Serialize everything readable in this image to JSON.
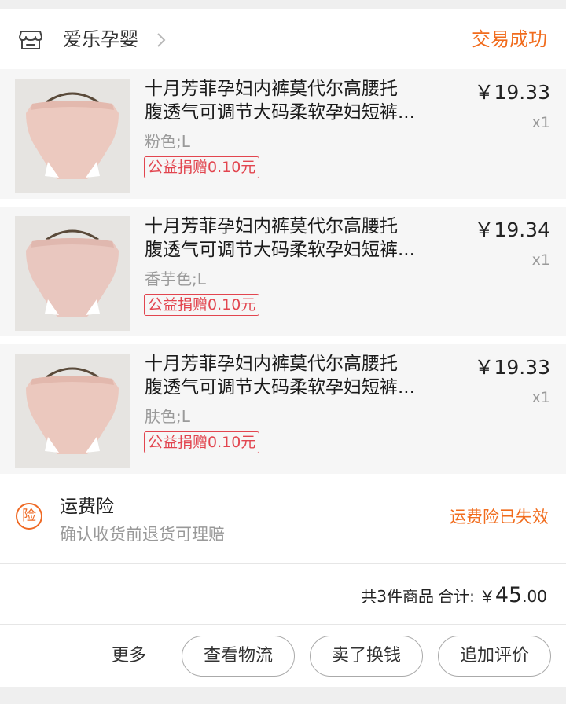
{
  "shop": {
    "name": "爱乐孕婴",
    "status": "交易成功",
    "icon": "store-icon"
  },
  "items": [
    {
      "title_line1": "十月芳菲孕妇内裤莫代尔高腰托",
      "title_line2": "腹透气可调节大码柔软孕妇短裤...",
      "sku": "粉色;L",
      "donation": "公益捐赠0.10元",
      "price": "￥19.33",
      "qty": "x1"
    },
    {
      "title_line1": "十月芳菲孕妇内裤莫代尔高腰托",
      "title_line2": "腹透气可调节大码柔软孕妇短裤...",
      "sku": "香芋色;L",
      "donation": "公益捐赠0.10元",
      "price": "￥19.34",
      "qty": "x1"
    },
    {
      "title_line1": "十月芳菲孕妇内裤莫代尔高腰托",
      "title_line2": "腹透气可调节大码柔软孕妇短裤...",
      "sku": "肤色;L",
      "donation": "公益捐赠0.10元",
      "price": "￥19.33",
      "qty": "x1"
    }
  ],
  "insurance": {
    "badge": "险",
    "title": "运费险",
    "desc": "确认收货前退货可理赔",
    "status": "运费险已失效"
  },
  "summary": {
    "count": "共3件商品",
    "label": "合计:",
    "currency": "￥",
    "amount_int": "45",
    "amount_dec": ".00"
  },
  "actions": {
    "more": "更多",
    "logistics": "查看物流",
    "sell": "卖了换钱",
    "review": "追加评价"
  },
  "colors": {
    "accent": "#f16c1d",
    "donation": "#e2454f",
    "background": "#efefef"
  }
}
